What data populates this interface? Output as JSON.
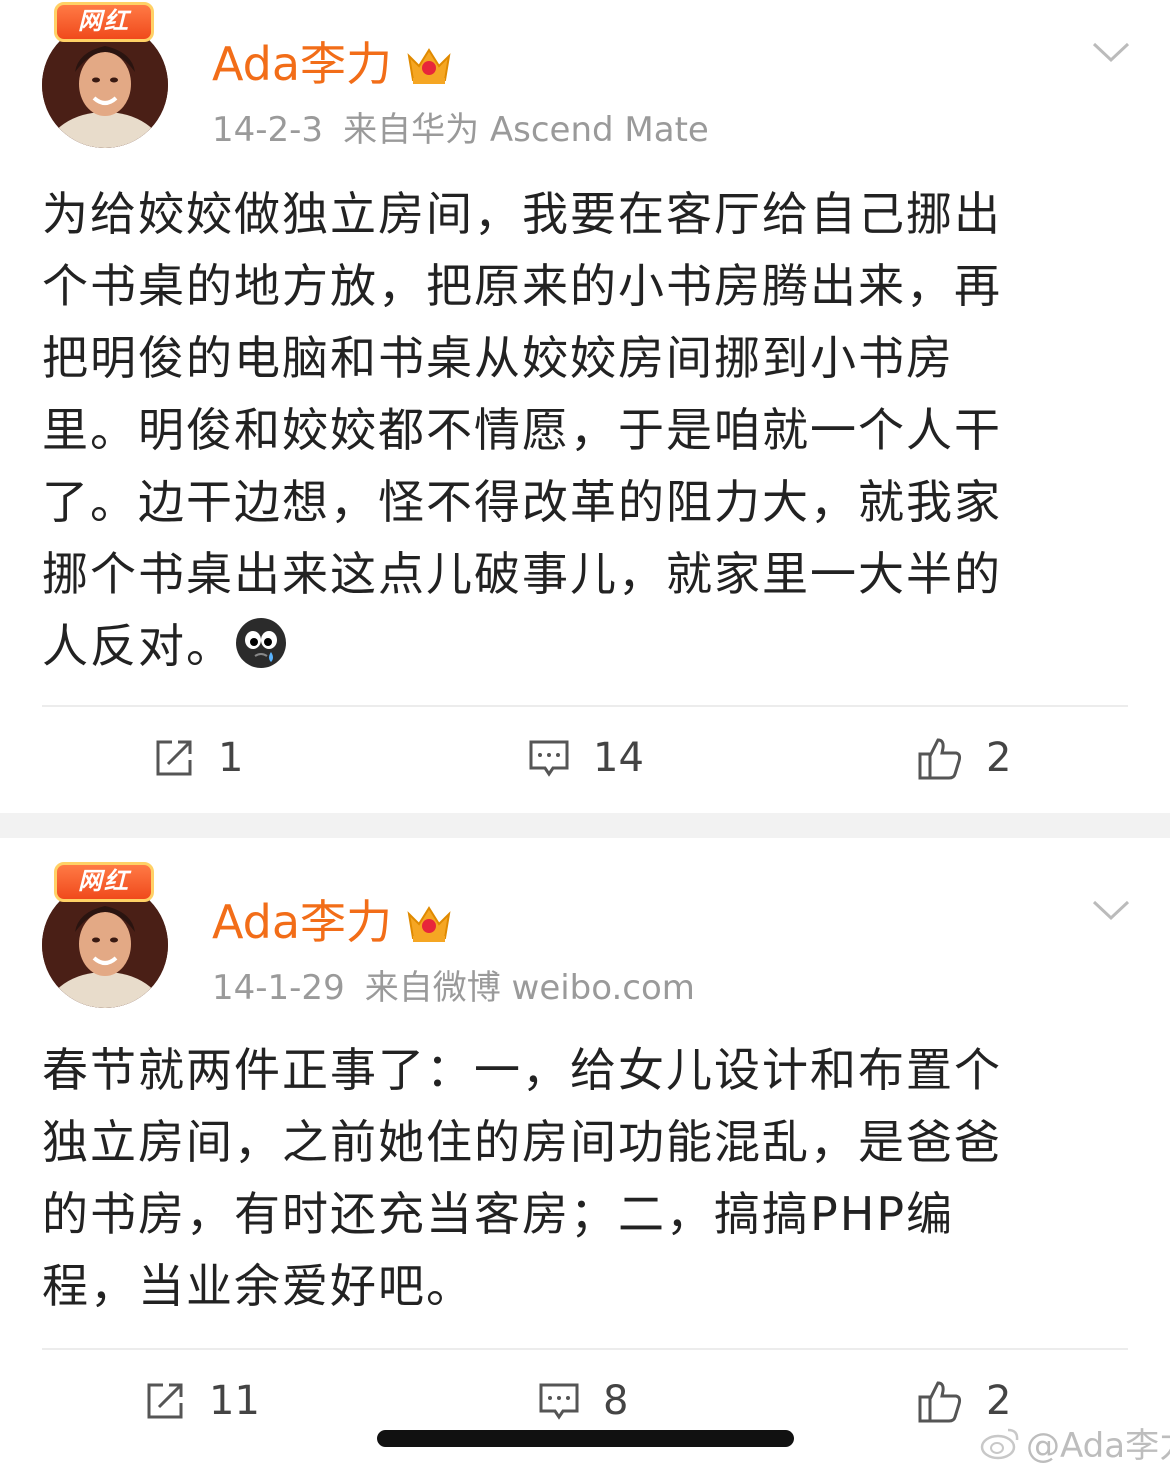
{
  "posts": [
    {
      "badge": "网红",
      "username": "Ada李力",
      "date": "14-2-3",
      "source": "来自华为 Ascend Mate",
      "content_lines": [
        "为给姣姣做独立房间，我要在客厅给自己挪出",
        "个书桌的地方放，把原来的小书房腾出来，再",
        "把明俊的电脑和书桌从姣姣房间挪到小书房",
        "里。明俊和姣姣都不情愿，于是咱就一个人干",
        "了。边干边想，怪不得改革的阻力大，就我家",
        "挪个书桌出来这点儿破事儿，就家里一大半的",
        "人反对。"
      ],
      "reposts": "1",
      "comments": "14",
      "likes": "2"
    },
    {
      "badge": "网红",
      "username": "Ada李力",
      "date": "14-1-29",
      "source": "来自微博 weibo.com",
      "content_lines": [
        "春节就两件正事了：一，给女儿设计和布置个",
        "独立房间，之前她住的房间功能混乱，是爸爸",
        "的书房，有时还充当客房；二，搞搞PHP编",
        "程，当业余爱好吧。"
      ],
      "reposts": "11",
      "comments": "8",
      "likes": "2"
    }
  ],
  "watermark": "@Ada李力",
  "icons": {
    "badge": "wanghong-badge-icon",
    "crown": "crown-icon",
    "more": "chevron-down-icon",
    "repost": "repost-icon",
    "comment": "comment-icon",
    "like": "thumbs-up-icon",
    "emoji": "crying-emoji-icon",
    "watermark": "weibo-logo-icon"
  },
  "colors": {
    "username": "#f26d18",
    "meta": "#9a9a9a",
    "text": "#222222",
    "separator": "#f2f2f2"
  }
}
